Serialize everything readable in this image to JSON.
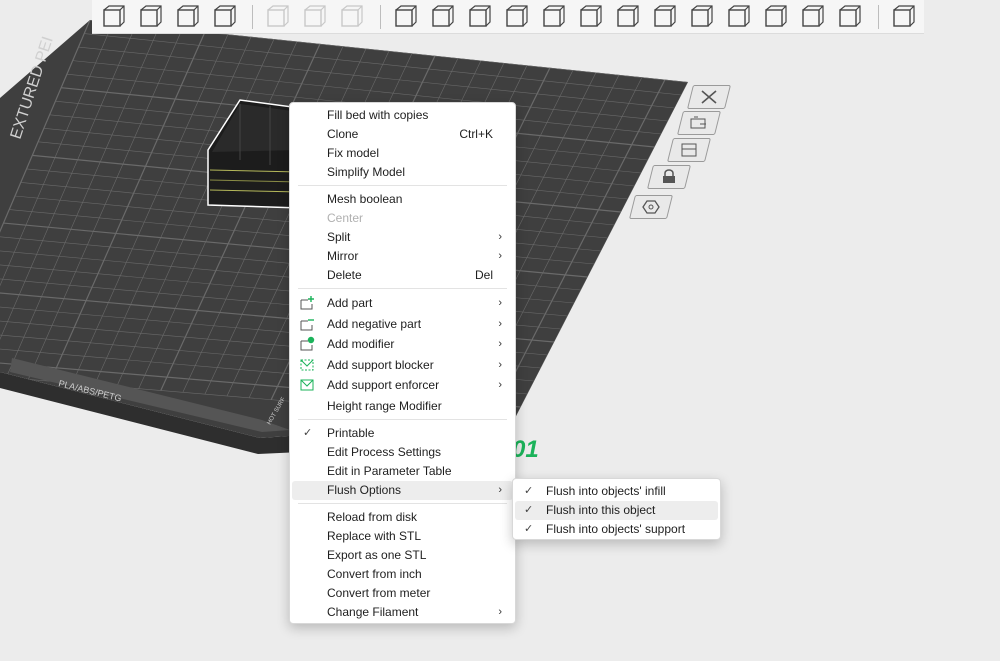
{
  "colors": {
    "bed": "#3f3f3f",
    "bed_grid": "#6a6a6a",
    "accent": "#1bb35a",
    "menu_bg": "#ffffff",
    "menu_hover": "#ededed"
  },
  "bed": {
    "label_left": "PLA/ABS/PETG",
    "label_side": "EXTURED PEI",
    "label_corner": "HOT SURF",
    "plate_number": "01"
  },
  "toolbar": {
    "icons": [
      "add-cube-icon",
      "arrange-grid-icon",
      "auto-orient-icon",
      "plate-layout-icon",
      "copy-icon",
      "paste-icon",
      "delete-list-icon",
      "move-icon",
      "rotate-icon",
      "scale-icon",
      "lay-on-face-icon",
      "cut-icon",
      "mesh-boolean-icon",
      "support-paint-icon",
      "seam-paint-icon",
      "cube-edit-icon",
      "text-icon",
      "color-paint-icon",
      "measure-icon",
      "assembly-icon",
      "split-parts-icon"
    ]
  },
  "context_menu": {
    "items": [
      {
        "label": "Fill bed with copies"
      },
      {
        "label": "Clone",
        "shortcut": "Ctrl+K"
      },
      {
        "label": "Fix model"
      },
      {
        "label": "Simplify Model"
      },
      {
        "label": "Mesh boolean"
      },
      {
        "label": "Center"
      },
      {
        "label": "Split"
      },
      {
        "label": "Mirror"
      },
      {
        "label": "Delete",
        "shortcut": "Del"
      },
      {
        "label": "Add part"
      },
      {
        "label": "Add negative part"
      },
      {
        "label": "Add modifier"
      },
      {
        "label": "Add support blocker"
      },
      {
        "label": "Add support enforcer"
      },
      {
        "label": "Height range Modifier"
      },
      {
        "label": "Printable",
        "checked": true
      },
      {
        "label": "Edit Process Settings"
      },
      {
        "label": "Edit in Parameter Table"
      },
      {
        "label": "Flush Options"
      },
      {
        "label": "Reload from disk"
      },
      {
        "label": "Replace with STL"
      },
      {
        "label": "Export as one STL"
      },
      {
        "label": "Convert from inch"
      },
      {
        "label": "Convert from meter"
      },
      {
        "label": "Change Filament"
      }
    ]
  },
  "flush_submenu": {
    "items": [
      {
        "label": "Flush into objects' infill",
        "checked": true
      },
      {
        "label": "Flush into this object",
        "checked": true
      },
      {
        "label": "Flush into objects' support",
        "checked": true
      }
    ]
  }
}
